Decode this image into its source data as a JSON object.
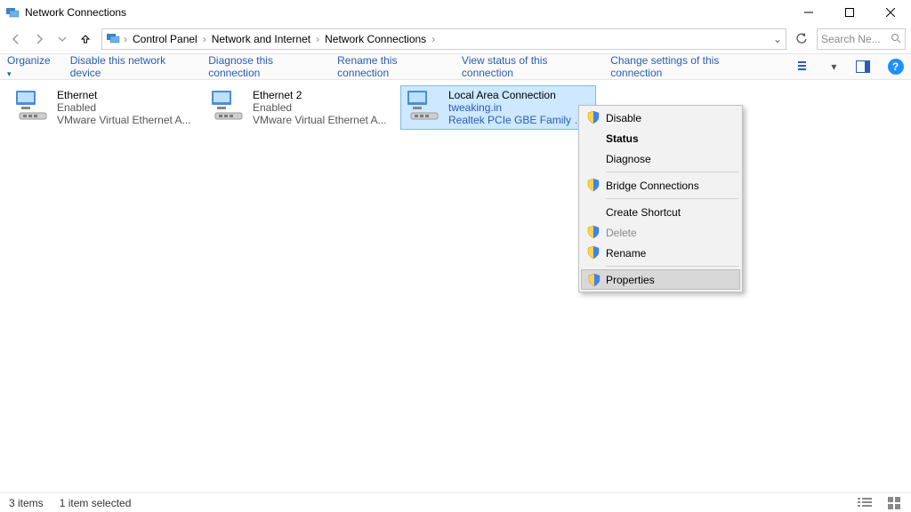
{
  "window": {
    "title": "Network Connections"
  },
  "breadcrumbs": {
    "root": "Control Panel",
    "mid": "Network and Internet",
    "leaf": "Network Connections"
  },
  "search": {
    "placeholder": "Search Ne..."
  },
  "commands": {
    "organize": "Organize",
    "disable": "Disable this network device",
    "diagnose": "Diagnose this connection",
    "rename": "Rename this connection",
    "viewstatus": "View status of this connection",
    "changeset": "Change settings of this connection"
  },
  "adapters": [
    {
      "name": "Ethernet",
      "line2": "Enabled",
      "line3": "VMware Virtual Ethernet A...",
      "selected": false
    },
    {
      "name": "Ethernet 2",
      "line2": "Enabled",
      "line3": "VMware Virtual Ethernet A...",
      "selected": false
    },
    {
      "name": "Local Area Connection",
      "line2": "tweaking.in",
      "line3": "Realtek PCIe GBE Family C...",
      "selected": true
    }
  ],
  "ctx": {
    "disable": "Disable",
    "status": "Status",
    "diagnose": "Diagnose",
    "bridge": "Bridge Connections",
    "shortcut": "Create Shortcut",
    "delete": "Delete",
    "rename": "Rename",
    "properties": "Properties"
  },
  "statusbar": {
    "items": "3 items",
    "selected": "1 item selected"
  }
}
